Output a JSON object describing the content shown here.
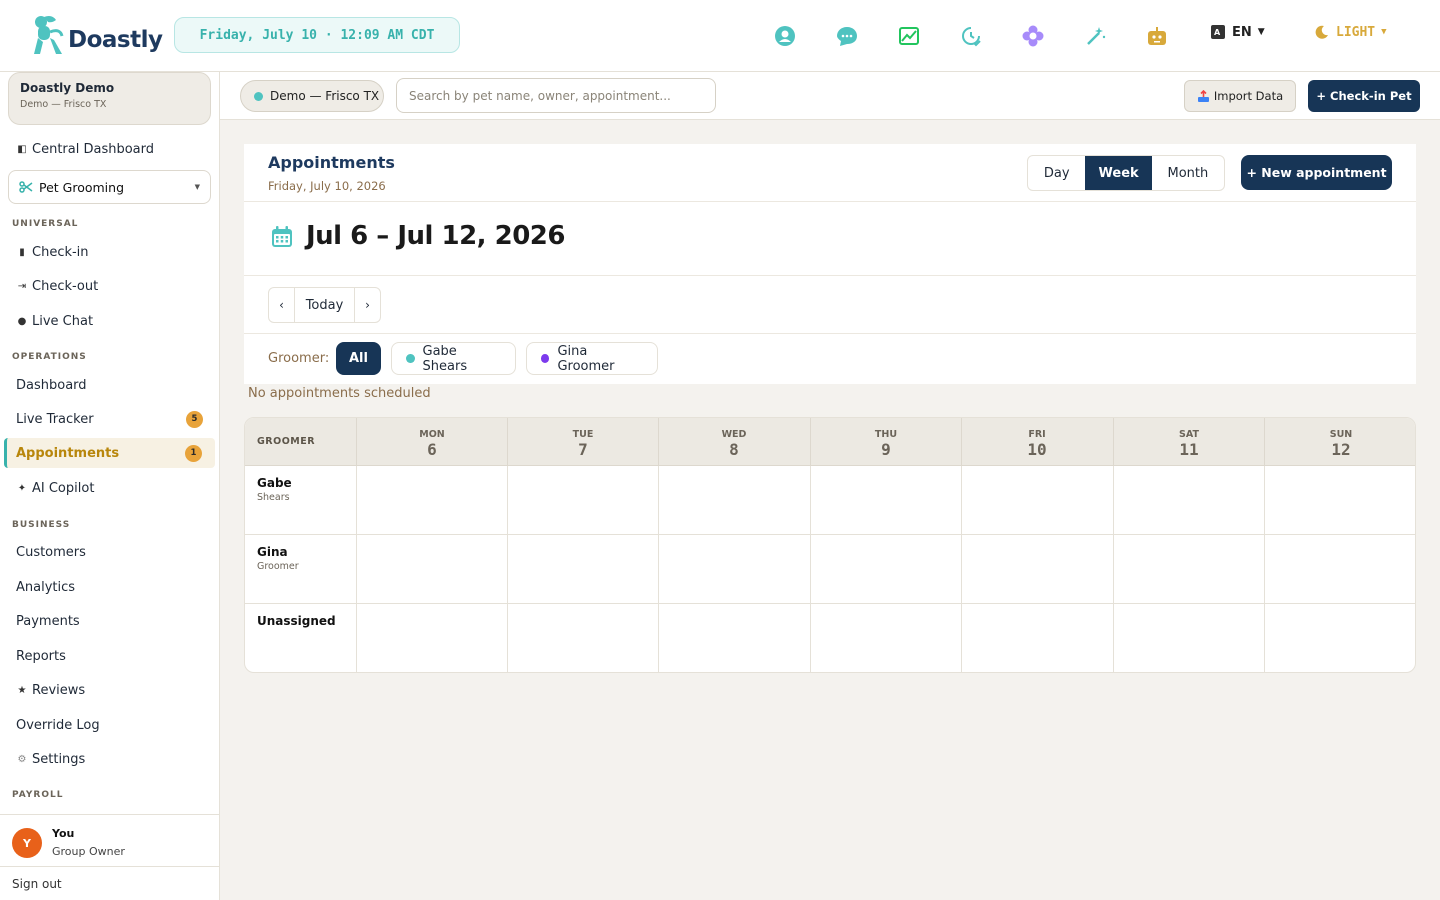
{
  "brand": {
    "name": "Doastly"
  },
  "header": {
    "datetime": "Friday, July 10 · 12:09 AM CDT",
    "language": "EN",
    "theme": "LIGHT",
    "icons": [
      "person-circle-icon",
      "chat-bubble-icon",
      "chart-image-icon",
      "clock-check-icon",
      "flower-icon",
      "magic-wand-icon",
      "robot-icon"
    ],
    "colors": {
      "teal": "#38b2ac",
      "navy": "#173556",
      "amber": "#d8a93b"
    }
  },
  "sidebar": {
    "org_name": "Doastly Demo",
    "org_sub": "Demo — Frisco TX",
    "central_dashboard": "Central Dashboard",
    "module": "Pet Grooming",
    "sections": {
      "universal": "UNIVERSAL",
      "operations": "OPERATIONS",
      "business": "BUSINESS",
      "payroll": "PAYROLL"
    },
    "universal_items": [
      "Check-in",
      "Check-out",
      "Live Chat"
    ],
    "operations_items": {
      "dashboard": "Dashboard",
      "live_tracker": "Live Tracker",
      "live_tracker_badge": "5",
      "appointments": "Appointments",
      "appointments_badge": "1",
      "ai_copilot": "AI Copilot"
    },
    "business_items": [
      "Customers",
      "Analytics",
      "Payments",
      "Reports",
      "Reviews",
      "Override Log",
      "Settings"
    ],
    "user": {
      "initial": "Y",
      "name": "You",
      "role": "Group Owner"
    },
    "sign_out": "Sign out"
  },
  "subheader": {
    "location": "Demo — Frisco TX",
    "search_placeholder": "Search by pet name, owner, appointment...",
    "import_label": "Import Data",
    "checkin_label": "+ Check-in Pet"
  },
  "appointments": {
    "title": "Appointments",
    "date": "Friday, July 10, 2026",
    "views": [
      "Day",
      "Week",
      "Month"
    ],
    "active_view": "Week",
    "new_label": "+ New appointment",
    "range": "Jul 6 – Jul 12, 2026",
    "today_label": "Today",
    "prev": "‹",
    "next": "›",
    "filter_label": "Groomer:",
    "filters": {
      "all": "All",
      "gabe": "Gabe Shears",
      "gabe_color": "#4fc3c0",
      "gina": "Gina Groomer",
      "gina_color": "#7c3aed"
    },
    "empty": "No appointments scheduled"
  },
  "schedule": {
    "groomer_header": "GROOMER",
    "days": [
      {
        "name": "MON",
        "num": "6"
      },
      {
        "name": "TUE",
        "num": "7"
      },
      {
        "name": "WED",
        "num": "8"
      },
      {
        "name": "THU",
        "num": "9"
      },
      {
        "name": "FRI",
        "num": "10"
      },
      {
        "name": "SAT",
        "num": "11"
      },
      {
        "name": "SUN",
        "num": "12"
      }
    ],
    "rows": [
      {
        "name": "Gabe",
        "sub": "Shears"
      },
      {
        "name": "Gina",
        "sub": "Groomer"
      },
      {
        "name": "Unassigned",
        "sub": ""
      }
    ]
  }
}
